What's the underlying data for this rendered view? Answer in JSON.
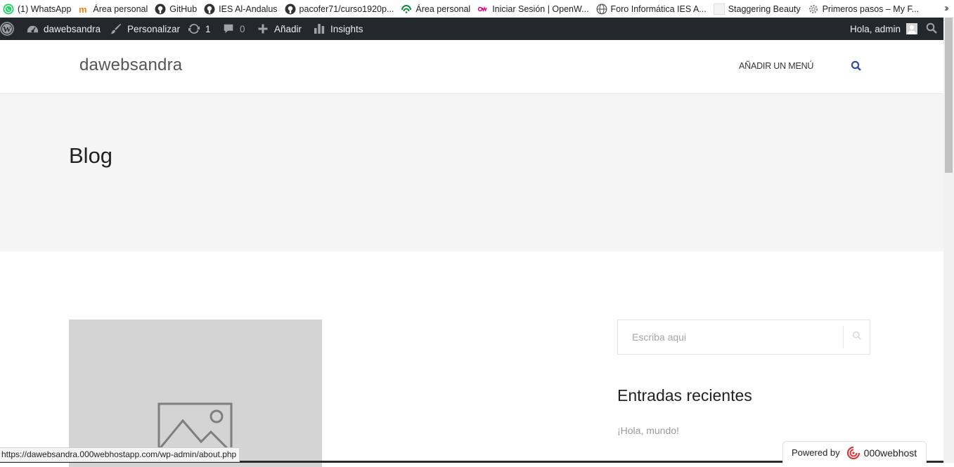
{
  "bookmarks": [
    {
      "label": "(1) WhatsApp",
      "icon": "whatsapp-icon"
    },
    {
      "label": "Área personal",
      "icon": "moodle-icon"
    },
    {
      "label": "GitHub",
      "icon": "github-icon"
    },
    {
      "label": "IES Al-Andalus",
      "icon": "github-icon"
    },
    {
      "label": "pacofer71/curso1920p...",
      "icon": "github-icon"
    },
    {
      "label": "Área personal",
      "icon": "junta-icon"
    },
    {
      "label": "Iniciar Sesión | OpenW...",
      "icon": "openwebinars-icon"
    },
    {
      "label": "Foro Informática IES A...",
      "icon": "globe-icon"
    },
    {
      "label": "Staggering Beauty",
      "icon": "blank-page-icon"
    },
    {
      "label": "Primeros pasos – My F...",
      "icon": "gear-icon"
    }
  ],
  "bookmarks_more_icon": "double-chevron-right-icon",
  "admin_bar": {
    "site_name": "dawebsandra",
    "customize": "Personalizar",
    "updates_count": "1",
    "comments_count": "0",
    "new_label": "Añadir",
    "insights_label": "Insights",
    "greeting": "Hola, admin"
  },
  "header": {
    "site_title": "dawebsandra",
    "menu_link": "AÑADIR UN MENÚ"
  },
  "page": {
    "title": "Blog"
  },
  "sidebar": {
    "search_placeholder": "Escriba aqui",
    "recent_title": "Entradas recientes",
    "recent_posts": [
      "¡Hola, mundo!"
    ]
  },
  "status_bar": {
    "url": "https://dawebsandra.000webhostapp.com/wp-admin/about.php"
  },
  "badge": {
    "powered_by": "Powered by",
    "brand": "000webhost"
  },
  "colors": {
    "admin_bar_bg": "#23282d",
    "accent_blue": "#2f4ea1",
    "hero_bg": "#f5f5f5",
    "placeholder_bg": "#d4d4d4"
  }
}
